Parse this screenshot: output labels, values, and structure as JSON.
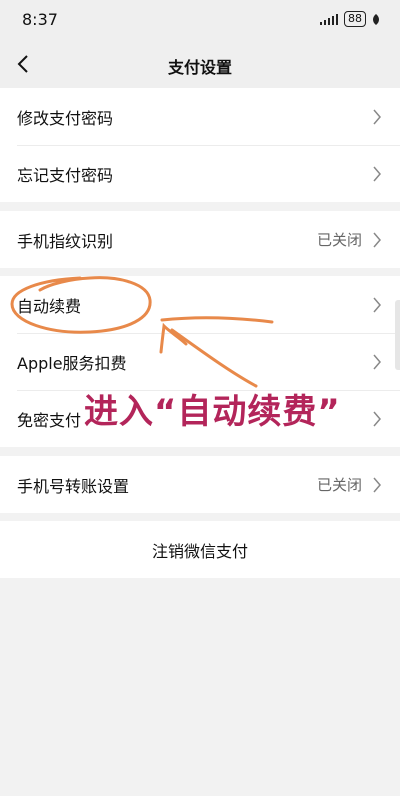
{
  "status_bar": {
    "time": "8:37",
    "battery": "88"
  },
  "nav": {
    "title": "支付设置"
  },
  "groups": {
    "g1": [
      {
        "label": "修改支付密码"
      },
      {
        "label": "忘记支付密码"
      }
    ],
    "g2": [
      {
        "label": "手机指纹识别",
        "value": "已关闭"
      }
    ],
    "g3": [
      {
        "label": "自动续费"
      },
      {
        "label": "Apple服务扣费"
      },
      {
        "label": "免密支付"
      }
    ],
    "g4": [
      {
        "label": "手机号转账设置",
        "value": "已关闭"
      }
    ],
    "g5": [
      {
        "label": "注销微信支付"
      }
    ]
  },
  "annotation": {
    "text": "进入“自动续费”",
    "color": "#b3255a",
    "marker_color": "#e8894a"
  }
}
